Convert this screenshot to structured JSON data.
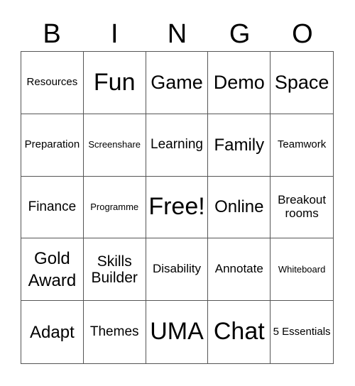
{
  "header": {
    "letters": [
      "B",
      "I",
      "N",
      "G",
      "O"
    ]
  },
  "board": {
    "rows": [
      [
        "Resources",
        "Fun",
        "Game",
        "Demo",
        "Space"
      ],
      [
        "Preparation",
        "Screenshare",
        "Learning",
        "Family",
        "Teamwork"
      ],
      [
        "Finance",
        "Programme",
        "Free!",
        "Online",
        "Breakout rooms"
      ],
      [
        "Gold Award",
        "Skills Builder",
        "Disability",
        "Annotate",
        "Whiteboard"
      ],
      [
        "Adapt",
        "Themes",
        "UMA",
        "Chat",
        "5 Essentials"
      ]
    ]
  }
}
